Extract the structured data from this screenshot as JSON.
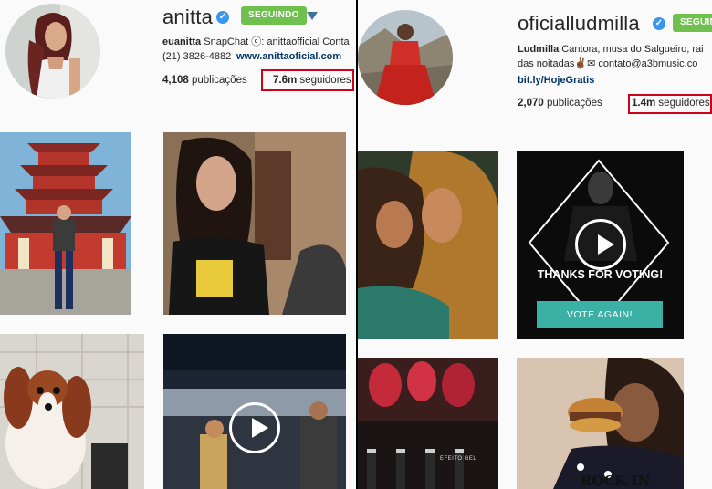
{
  "left": {
    "username": "anitta",
    "follow_button": "SEGUINDO",
    "bio_handle": "euanitta",
    "bio_text": " SnapChat ⓒ: anittaofficial Conta",
    "phone": "(21) 3826-4882",
    "website": "www.anittaoficial.com",
    "posts_count": "4,108",
    "posts_label": "publicações",
    "followers_count": "7.6m",
    "followers_label": "seguidores"
  },
  "right": {
    "username": "oficialludmilla",
    "follow_button": "SEGUINDO",
    "bio_name": "Ludmilla",
    "bio_text": " Cantora, musa do Salgueiro, rai",
    "bio_text2": "das noitadas✌🏾✉ contato@a3bmusic.co",
    "website": "bit.ly/HojeGratis",
    "posts_count": "2,070",
    "posts_label": "publicações",
    "followers_count": "1.4m",
    "followers_label": "seguidores",
    "video_caption": "THANKS FOR VOTING!",
    "vote_button": "VOTE AGAIN!",
    "food_caption": "ROCK IN",
    "product_caption": "EFEITO GEL"
  },
  "colors": {
    "verified": "#3897f0",
    "follow_green": "#70c050",
    "highlight_red": "#d0021b",
    "link_blue": "#003569",
    "vote_teal": "#3bb0a4"
  },
  "icons": [
    "verified-badge-icon",
    "dropdown-caret-icon",
    "play-icon"
  ]
}
